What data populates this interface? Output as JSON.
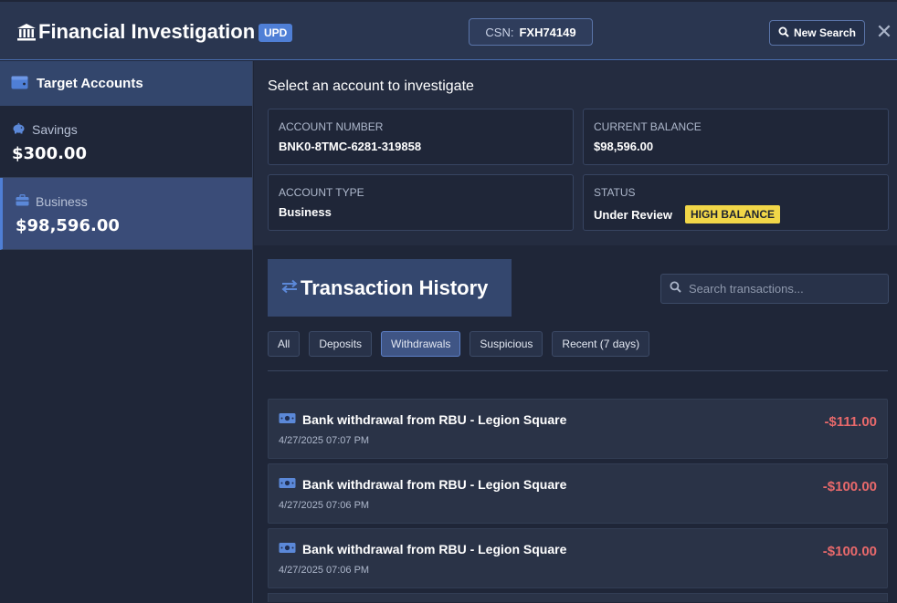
{
  "header": {
    "title": "Financial Investigation",
    "badge": "UPD",
    "csn_label": "CSN:",
    "csn_value": "FXH74149",
    "new_search_label": "New Search",
    "close_glyph": "✕"
  },
  "sidebar": {
    "heading": "Target Accounts",
    "accounts": [
      {
        "type": "Savings",
        "balance": "$300.00",
        "icon": "piggy-bank-icon"
      },
      {
        "type": "Business",
        "balance": "$98,596.00",
        "icon": "briefcase-icon",
        "active": true
      }
    ]
  },
  "summary": {
    "prompt": "Select an account to investigate",
    "account_number_label": "ACCOUNT NUMBER",
    "account_number": "BNK0-8TMC-6281-319858",
    "current_balance_label": "CURRENT BALANCE",
    "current_balance": "$98,596.00",
    "account_type_label": "ACCOUNT TYPE",
    "account_type": "Business",
    "status_label": "STATUS",
    "status": "Under Review",
    "status_badge": "HIGH BALANCE"
  },
  "transactions": {
    "title": "Transaction History",
    "search_placeholder": "Search transactions...",
    "filters": [
      "All",
      "Deposits",
      "Withdrawals",
      "Suspicious",
      "Recent (7 days)"
    ],
    "active_filter": "Withdrawals",
    "items": [
      {
        "description": "Bank withdrawal from RBU - Legion Square",
        "date": "4/27/2025 07:07 PM",
        "amount": "-$111.00"
      },
      {
        "description": "Bank withdrawal from RBU - Legion Square",
        "date": "4/27/2025 07:06 PM",
        "amount": "-$100.00"
      },
      {
        "description": "Bank withdrawal from RBU - Legion Square",
        "date": "4/27/2025 07:06 PM",
        "amount": "-$100.00"
      }
    ]
  },
  "colors": {
    "accent": "#4f7fd6",
    "withdrawal": "#e8696b",
    "warning_badge": "#f1d648"
  }
}
